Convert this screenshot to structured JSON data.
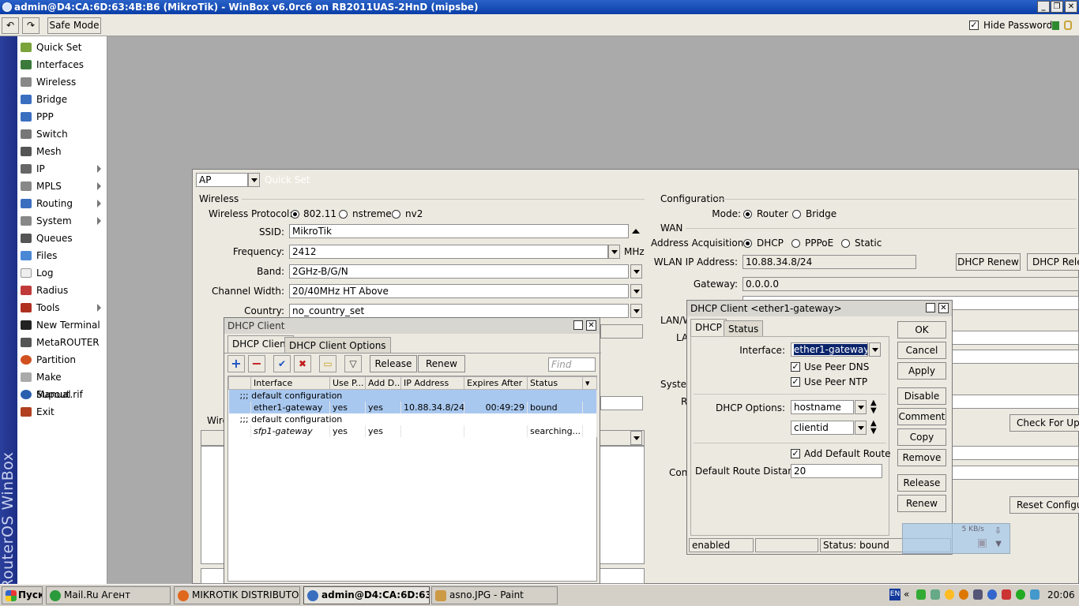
{
  "title": "admin@D4:CA:6D:63:4B:B6 (MikroTik) - WinBox v6.0rc6 on RB2011UAS-2HnD (mipsbe)",
  "toolbar": {
    "safe_mode": "Safe Mode",
    "hide_passwords": "Hide Passwords",
    "hide_passwords_checked": true
  },
  "brand_strip": "RouterOS WinBox",
  "sidebar": {
    "items": [
      {
        "label": "Quick Set",
        "color": "#7aa33a"
      },
      {
        "label": "Interfaces",
        "color": "#3b7a3b"
      },
      {
        "label": "Wireless",
        "color": "#888"
      },
      {
        "label": "Bridge",
        "color": "#3a6fc0"
      },
      {
        "label": "PPP",
        "color": "#3a6fc0"
      },
      {
        "label": "Switch",
        "color": "#777"
      },
      {
        "label": "Mesh",
        "color": "#555"
      },
      {
        "label": "IP",
        "color": "#666"
      },
      {
        "label": "MPLS",
        "color": "#888"
      },
      {
        "label": "Routing",
        "color": "#3a6fc0"
      },
      {
        "label": "System",
        "color": "#888"
      },
      {
        "label": "Queues",
        "color": "#555"
      },
      {
        "label": "Files",
        "color": "#4a88d6"
      },
      {
        "label": "Log",
        "color": "#eee"
      },
      {
        "label": "Radius",
        "color": "#c03a3a"
      },
      {
        "label": "Tools",
        "color": "#b03020"
      },
      {
        "label": "New Terminal",
        "color": "#222"
      },
      {
        "label": "MetaROUTER",
        "color": "#555"
      },
      {
        "label": "Partition",
        "color": "#d05020"
      },
      {
        "label": "Make Supout.rif",
        "color": "#aaa"
      },
      {
        "label": "Manual",
        "color": "#2a5fb0"
      },
      {
        "label": "Exit",
        "color": "#b04020"
      }
    ]
  },
  "quickset": {
    "mode_select": "AP",
    "title": "Quick Set",
    "wireless_group": "Wireless",
    "protocol_label": "Wireless Protocol:",
    "protocol_options": [
      "802.11",
      "nstreme",
      "nv2"
    ],
    "ssid_label": "SSID:",
    "ssid": "MikroTik",
    "frequency_label": "Frequency:",
    "frequency": "2412",
    "frequency_unit": "MHz",
    "band_label": "Band:",
    "band": "2GHz-B/G/N",
    "channel_label": "Channel Width:",
    "channel": "20/40MHz HT Above",
    "country_label": "Country:",
    "country": "no_country_set",
    "wire_group": "Wire",
    "config_group": "Configuration",
    "mode_label": "Mode:",
    "mode_options": [
      "Router",
      "Bridge"
    ],
    "wan_group": "WAN",
    "addr_acq_label": "Address Acquisition:",
    "addr_options": [
      "DHCP",
      "PPPoE",
      "Static"
    ],
    "wlan_ip_label": "WLAN IP Address:",
    "wlan_ip": "10.88.34.8/24",
    "gateway_label": "Gateway:",
    "gateway": "0.0.0.0",
    "dhcp_renew": "DHCP Renew",
    "dhcp_release": "DHCP Relea",
    "lan_group": "LAN/W",
    "la_label": "LA",
    "system_group": "System",
    "r_label": "R",
    "check_updates": "Check For Updat",
    "conf_label": "Conf",
    "reset_config": "Reset Configurati"
  },
  "dhcp_client": {
    "title": "DHCP Client",
    "tabs": [
      "DHCP Client",
      "DHCP Client Options"
    ],
    "release": "Release",
    "renew": "Renew",
    "find_placeholder": "Find",
    "columns": [
      "Interface",
      "Use P...",
      "Add D...",
      "IP Address",
      "Expires After",
      "Status"
    ],
    "rows": [
      {
        "comment": ";;; default configuration"
      },
      {
        "interface": "ether1-gateway",
        "use_peer": "yes",
        "add_default": "yes",
        "ip": "10.88.34.8/24",
        "expires": "00:49:29",
        "status": "bound",
        "selected": true
      },
      {
        "comment": ";;; default configuration"
      },
      {
        "interface": "sfp1-gateway",
        "use_peer": "yes",
        "add_default": "yes",
        "ip": "",
        "expires": "",
        "status": "searching..."
      }
    ]
  },
  "dhcp_edit": {
    "title": "DHCP Client <ether1-gateway>",
    "tabs": [
      "DHCP",
      "Status"
    ],
    "interface_label": "Interface:",
    "interface": "ether1-gateway",
    "use_peer_dns": "Use Peer DNS",
    "use_peer_ntp": "Use Peer NTP",
    "dhcp_options_label": "DHCP Options:",
    "option1": "hostname",
    "option2": "clientid",
    "add_default_route": "Add Default Route",
    "route_distance_label": "Default Route Distance:",
    "route_distance": "20",
    "buttons": [
      "OK",
      "Cancel",
      "Apply",
      "Disable",
      "Comment",
      "Copy",
      "Remove",
      "Release",
      "Renew"
    ],
    "status_enabled": "enabled",
    "status_bound": "Status: bound"
  },
  "net_widget": {
    "rate": "5 KB/s"
  },
  "taskbar": {
    "start": "Пуск",
    "tasks": [
      "Mail.Ru Агент",
      "MIKROTIK DISTRIBUTOR...",
      "admin@D4:CA:6D:63:4...",
      "asno.JPG - Paint"
    ],
    "lang": "EN",
    "clock": "20:06"
  }
}
